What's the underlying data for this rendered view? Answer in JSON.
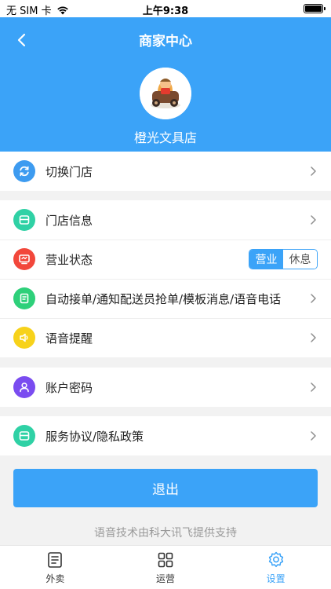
{
  "status_bar": {
    "carrier": "无 SIM 卡",
    "time": "上午9:38"
  },
  "header": {
    "title": "商家中心",
    "store_name": "橙光文具店"
  },
  "menu": {
    "switch_store": "切换门店",
    "store_info": "门店信息",
    "business_status": "营业状态",
    "status_toggle": {
      "open": "营业",
      "closed": "休息",
      "selected": "营业"
    },
    "auto_accept": "自动接单/通知配送员抢单/模板消息/语音电话",
    "voice_reminder": "语音提醒",
    "account_password": "账户密码",
    "service_agreement": "服务协议/隐私政策"
  },
  "logout_label": "退出",
  "footer_note": "语音技术由科大讯飞提供支持",
  "tabs": [
    {
      "label": "外卖",
      "icon": "list-icon"
    },
    {
      "label": "运营",
      "icon": "grid-icon"
    },
    {
      "label": "设置",
      "icon": "gear-icon",
      "active": true
    }
  ],
  "colors": {
    "primary": "#3ba3f8",
    "icon_switch": "#3d9bf0",
    "icon_store": "#2fd1a5",
    "icon_status": "#f2473b",
    "icon_auto": "#2ed07a",
    "icon_voice": "#f7d21b",
    "icon_account": "#7a4cf0",
    "icon_agreement": "#2fd1a5"
  }
}
